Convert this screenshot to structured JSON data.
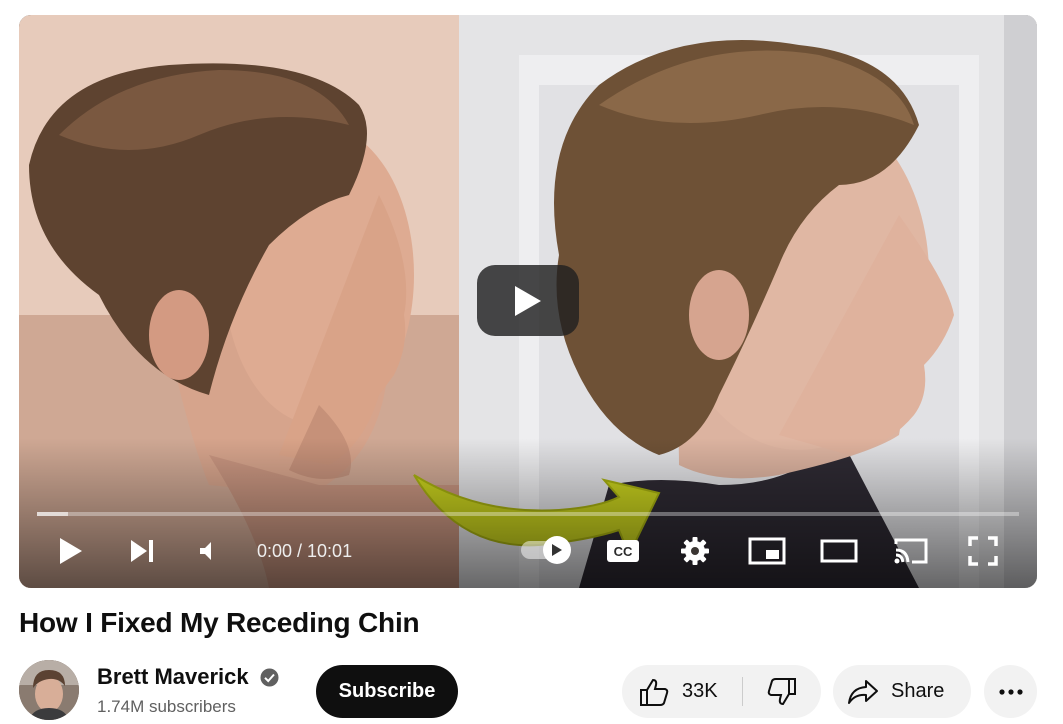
{
  "player": {
    "current_time": "0:00",
    "duration": "10:01",
    "time_display": "0:00 / 10:01",
    "progress_loaded_fraction": 0.032,
    "progress_played_fraction": 0.0,
    "autoplay": true,
    "thumbnail_description_icons": [
      "play-icon",
      "next-icon",
      "volume-icon",
      "autoplay-toggle",
      "cc-icon",
      "settings-icon",
      "miniplayer-icon",
      "theater-icon",
      "cast-icon",
      "fullscreen-icon"
    ],
    "arrow_color": "#c9d21e"
  },
  "video": {
    "title": "How I Fixed My Receding Chin"
  },
  "channel": {
    "name": "Brett Maverick",
    "subscribers": "1.74M subscribers",
    "verified": true
  },
  "actions": {
    "subscribe_label": "Subscribe",
    "like_count": "33K",
    "share_label": "Share",
    "more_icon": "more-horizontal-icon"
  },
  "colors": {
    "subscribe_bg": "#0f0f0f",
    "pill_bg": "#f2f2f2",
    "secondary_text": "#606060"
  }
}
